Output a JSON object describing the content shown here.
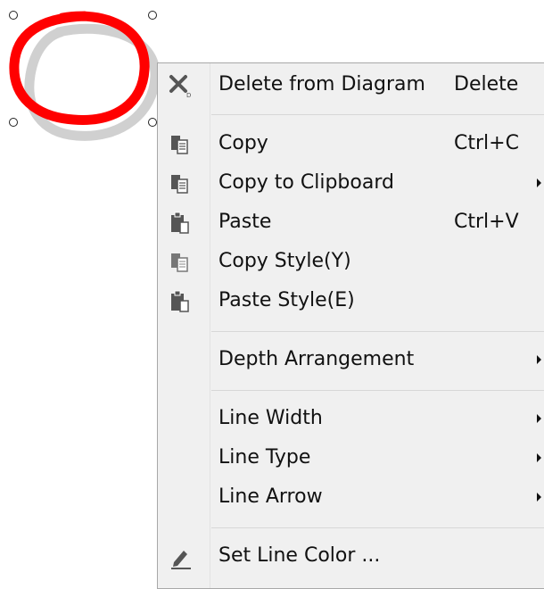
{
  "menu": {
    "items": [
      {
        "label": "Delete from Diagram",
        "shortcut": "Delete",
        "icon": "delete-x-icon"
      },
      {
        "label": "Copy",
        "shortcut": "Ctrl+C",
        "icon": "copy-icon"
      },
      {
        "label": "Copy to Clipboard",
        "icon": "copy-clipboard-icon",
        "submenu": true
      },
      {
        "label": "Paste",
        "shortcut": "Ctrl+V",
        "icon": "paste-icon"
      },
      {
        "label": "Copy Style(Y)",
        "icon": "copy-style-icon"
      },
      {
        "label": "Paste Style(E)",
        "icon": "paste-style-icon"
      },
      {
        "label": "Depth Arrangement",
        "submenu": true
      },
      {
        "label": "Line Width",
        "submenu": true
      },
      {
        "label": "Line Type",
        "submenu": true
      },
      {
        "label": "Line Arrow",
        "submenu": true
      },
      {
        "label": "Set Line Color ...",
        "icon": "pen-icon"
      }
    ]
  },
  "shape": {
    "stroke_color": "#ff0000",
    "shadow_color": "#d0d0d0"
  }
}
